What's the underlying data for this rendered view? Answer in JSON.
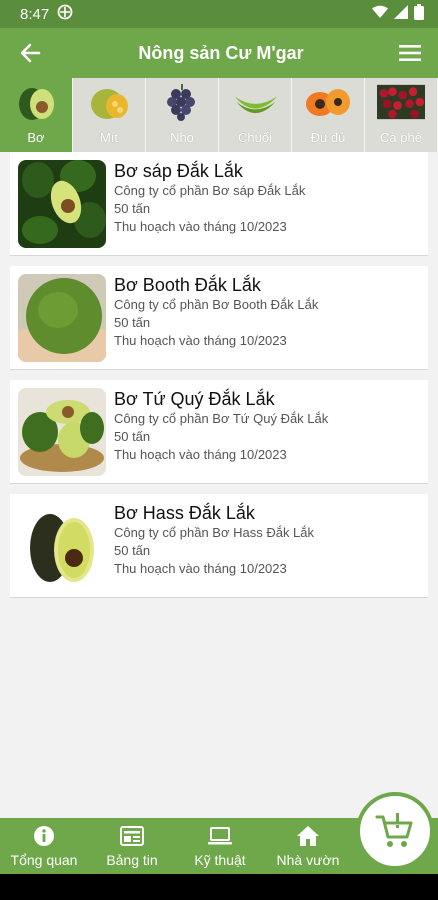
{
  "status": {
    "time": "8:47"
  },
  "app_bar": {
    "title": "Nông sản Cư M'gar"
  },
  "categories": [
    {
      "label": "Bơ",
      "icon": "avocado-icon"
    },
    {
      "label": "Mít",
      "icon": "jackfruit-icon"
    },
    {
      "label": "Nho",
      "icon": "grapes-icon"
    },
    {
      "label": "Chuối",
      "icon": "banana-icon"
    },
    {
      "label": "Đu đủ",
      "icon": "papaya-icon"
    },
    {
      "label": "Cà phê",
      "icon": "coffee-icon"
    }
  ],
  "products": [
    {
      "name": "Bơ sáp Đắk Lắk",
      "company": "Công ty cổ phần Bơ sáp Đắk Lắk",
      "quantity": "50 tấn",
      "harvest": "Thu hoạch vào tháng 10/2023"
    },
    {
      "name": "Bơ Booth Đắk Lắk",
      "company": "Công ty cổ phần Bơ Booth Đắk Lắk",
      "quantity": "50 tấn",
      "harvest": "Thu hoạch vào tháng 10/2023"
    },
    {
      "name": "Bơ Tứ Quý Đắk Lắk",
      "company": "Công ty cổ phần Bơ Tứ Quý Đắk Lắk",
      "quantity": "50 tấn",
      "harvest": "Thu hoạch vào tháng 10/2023"
    },
    {
      "name": "Bơ Hass Đắk Lắk",
      "company": "Công ty cổ phần Bơ Hass Đắk Lắk",
      "quantity": "50 tấn",
      "harvest": "Thu hoạch vào tháng 10/2023"
    }
  ],
  "bottom_nav": [
    {
      "label": "Tổng quan",
      "icon": "info-icon"
    },
    {
      "label": "Bảng tin",
      "icon": "news-icon"
    },
    {
      "label": "Kỹ thuật",
      "icon": "laptop-icon"
    },
    {
      "label": "Nhà vườn",
      "icon": "home-icon"
    }
  ],
  "colors": {
    "primary": "#6ea84a",
    "status_bar": "#5b8e3c",
    "category_strip": "#b6cf9b"
  }
}
